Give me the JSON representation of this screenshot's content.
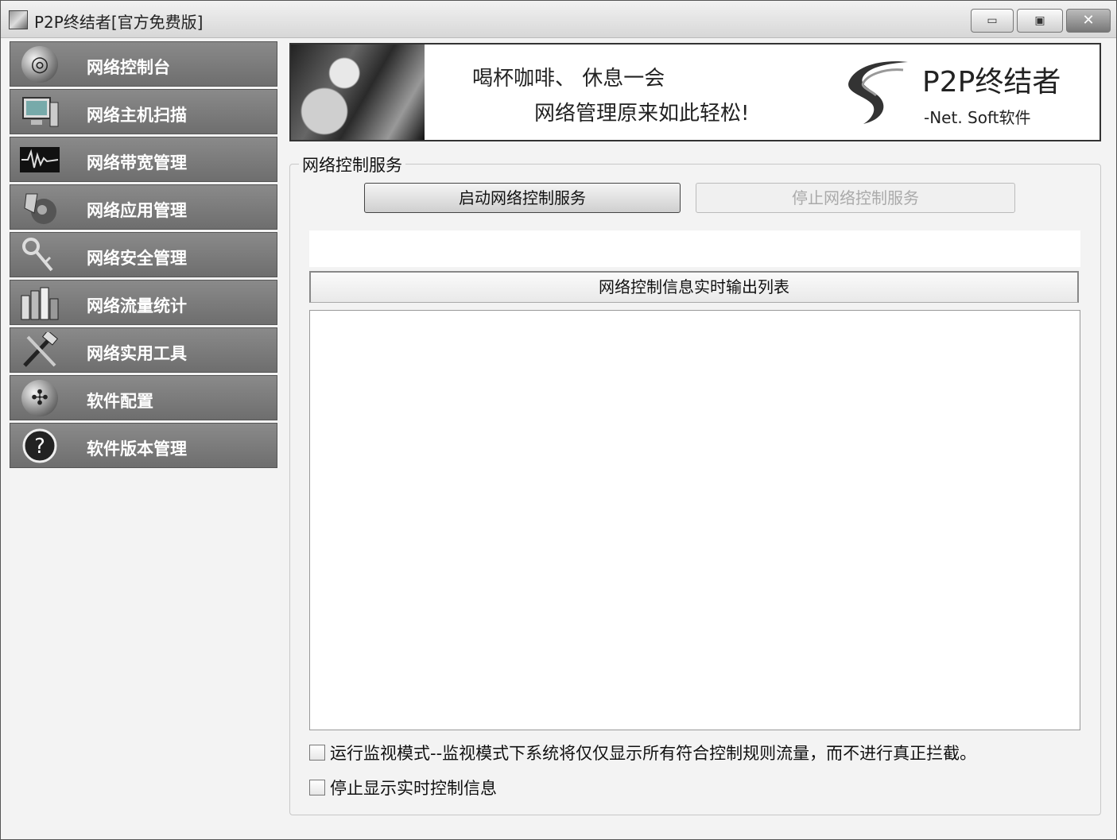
{
  "window": {
    "title": "P2P终结者[官方免费版]",
    "controls": {
      "minimize": "▭",
      "maximize": "▣",
      "close": "✕"
    }
  },
  "sidebar": {
    "items": [
      {
        "label": "网络控制台",
        "icon": "globe-icon"
      },
      {
        "label": "网络主机扫描",
        "icon": "computer-icon"
      },
      {
        "label": "网络带宽管理",
        "icon": "waveform-icon"
      },
      {
        "label": "网络应用管理",
        "icon": "apps-icon"
      },
      {
        "label": "网络安全管理",
        "icon": "keys-icon"
      },
      {
        "label": "网络流量统计",
        "icon": "bar-chart-icon"
      },
      {
        "label": "网络实用工具",
        "icon": "tools-icon"
      },
      {
        "label": "软件配置",
        "icon": "config-icon"
      },
      {
        "label": "软件版本管理",
        "icon": "help-icon"
      }
    ]
  },
  "banner": {
    "line1": "喝杯咖啡、  休息一会",
    "line2": "网络管理原来如此轻松!",
    "brand": "P2P终结者",
    "sub": "-Net. Soft软件"
  },
  "service": {
    "group_title": "网络控制服务",
    "start_label": "启动网络控制服务",
    "stop_label": "停止网络控制服务",
    "list_header": "网络控制信息实时输出列表",
    "monitor_mode_label": "运行监视模式--监视模式下系统将仅仅显示所有符合控制规则流量，而不进行真正拦截。",
    "stop_display_label": "停止显示实时控制信息"
  }
}
